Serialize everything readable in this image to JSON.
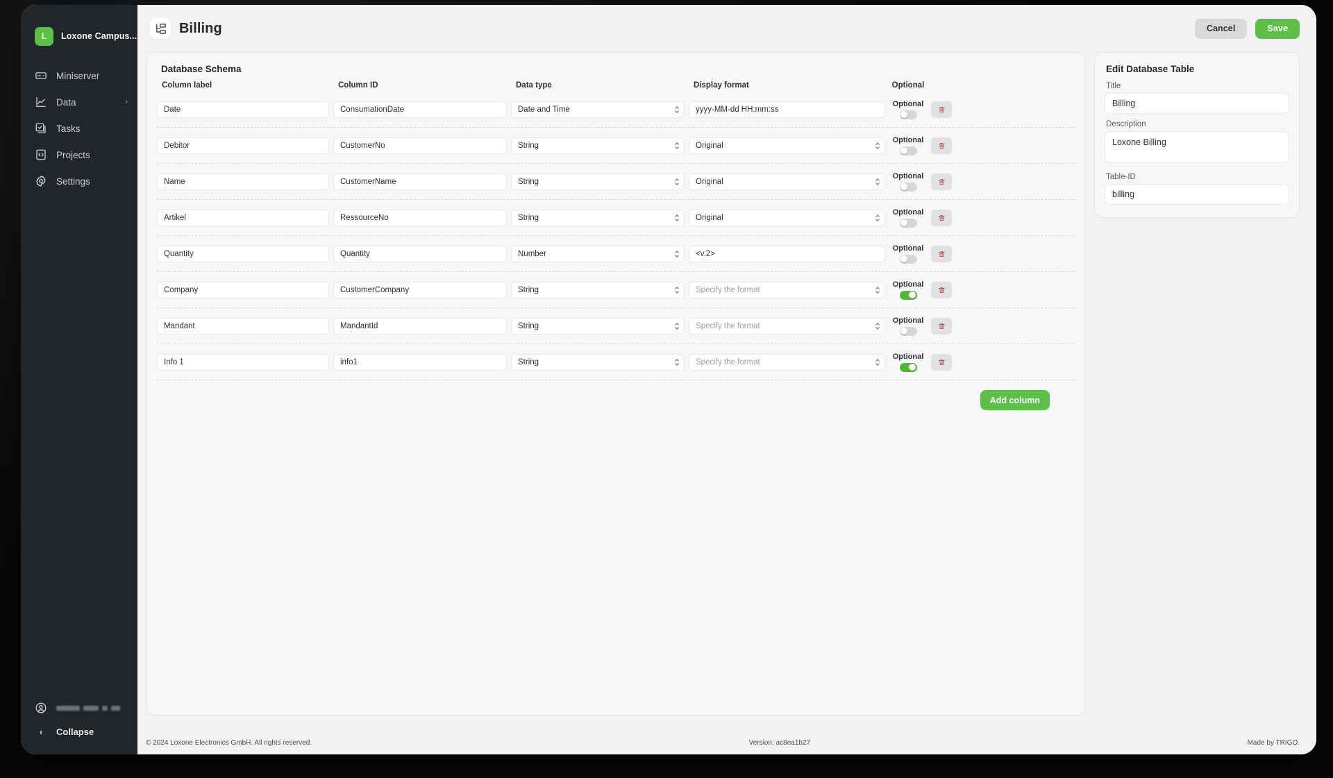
{
  "sidebar": {
    "brand": {
      "badge": "L",
      "name": "Loxone Campus..."
    },
    "items": [
      {
        "label": "Miniserver",
        "icon": "miniserver-icon",
        "chevron": ""
      },
      {
        "label": "Data",
        "icon": "chart-line-icon",
        "chevron": "›"
      },
      {
        "label": "Tasks",
        "icon": "checkbox-stack-icon",
        "chevron": ""
      },
      {
        "label": "Projects",
        "icon": "code-file-icon",
        "chevron": ""
      },
      {
        "label": "Settings",
        "icon": "gear-icon",
        "chevron": ""
      }
    ],
    "user": {
      "name_redacted": true
    },
    "collapse": {
      "label": "Collapse",
      "chevron": "‹"
    }
  },
  "topbar": {
    "icon": "hierarchy-table-icon",
    "title": "Billing",
    "cancel_label": "Cancel",
    "save_label": "Save"
  },
  "schema": {
    "title": "Database Schema",
    "headers": {
      "label": "Column label",
      "id": "Column ID",
      "type": "Data type",
      "format": "Display format",
      "optional": "Optional"
    },
    "add_column_label": "Add column",
    "delete_icon": "trash-icon",
    "stepper_icon": "stepper-updown-icon",
    "format_placeholder": "Specify the format",
    "rows": [
      {
        "label": "Date",
        "id": "ConsumationDate",
        "type": "Date and Time",
        "format": "yyyy-MM-dd HH:mm:ss",
        "format_is_select": false,
        "optional": false
      },
      {
        "label": "Debitor",
        "id": "CustomerNo",
        "type": "String",
        "format": "Original",
        "format_is_select": true,
        "optional": false
      },
      {
        "label": "Name",
        "id": "CustomerName",
        "type": "String",
        "format": "Original",
        "format_is_select": true,
        "optional": false
      },
      {
        "label": "Artikel",
        "id": "RessourceNo",
        "type": "String",
        "format": "Original",
        "format_is_select": true,
        "optional": false
      },
      {
        "label": "Quantity",
        "id": "Quantity",
        "type": "Number",
        "format": "<v.2>",
        "format_is_select": false,
        "optional": false
      },
      {
        "label": "Company",
        "id": "CustomerCompany",
        "type": "String",
        "format": "",
        "format_is_select": true,
        "optional": true
      },
      {
        "label": "Mandant",
        "id": "MandantId",
        "type": "String",
        "format": "",
        "format_is_select": true,
        "optional": false
      },
      {
        "label": "Info 1",
        "id": "info1",
        "type": "String",
        "format": "",
        "format_is_select": true,
        "optional": true
      }
    ]
  },
  "edit_panel": {
    "title": "Edit Database Table",
    "title_label": "Title",
    "title_value": "Billing",
    "description_label": "Description",
    "description_value": "Loxone Billing",
    "tableid_label": "Table-ID",
    "tableid_value": "billing"
  },
  "footer": {
    "copyright": "© 2024 Loxone Electronics GmbH. All rights reserved.",
    "version": "Version: ac8ea1b27",
    "made_by": "Made by TRIGO."
  },
  "colors": {
    "accent_green": "#5cc046",
    "toggle_on": "#4cbb33",
    "sidebar_bg": "#21262b",
    "delete_red": "#ef3b3b",
    "page_bg": "#f2f2f2"
  }
}
